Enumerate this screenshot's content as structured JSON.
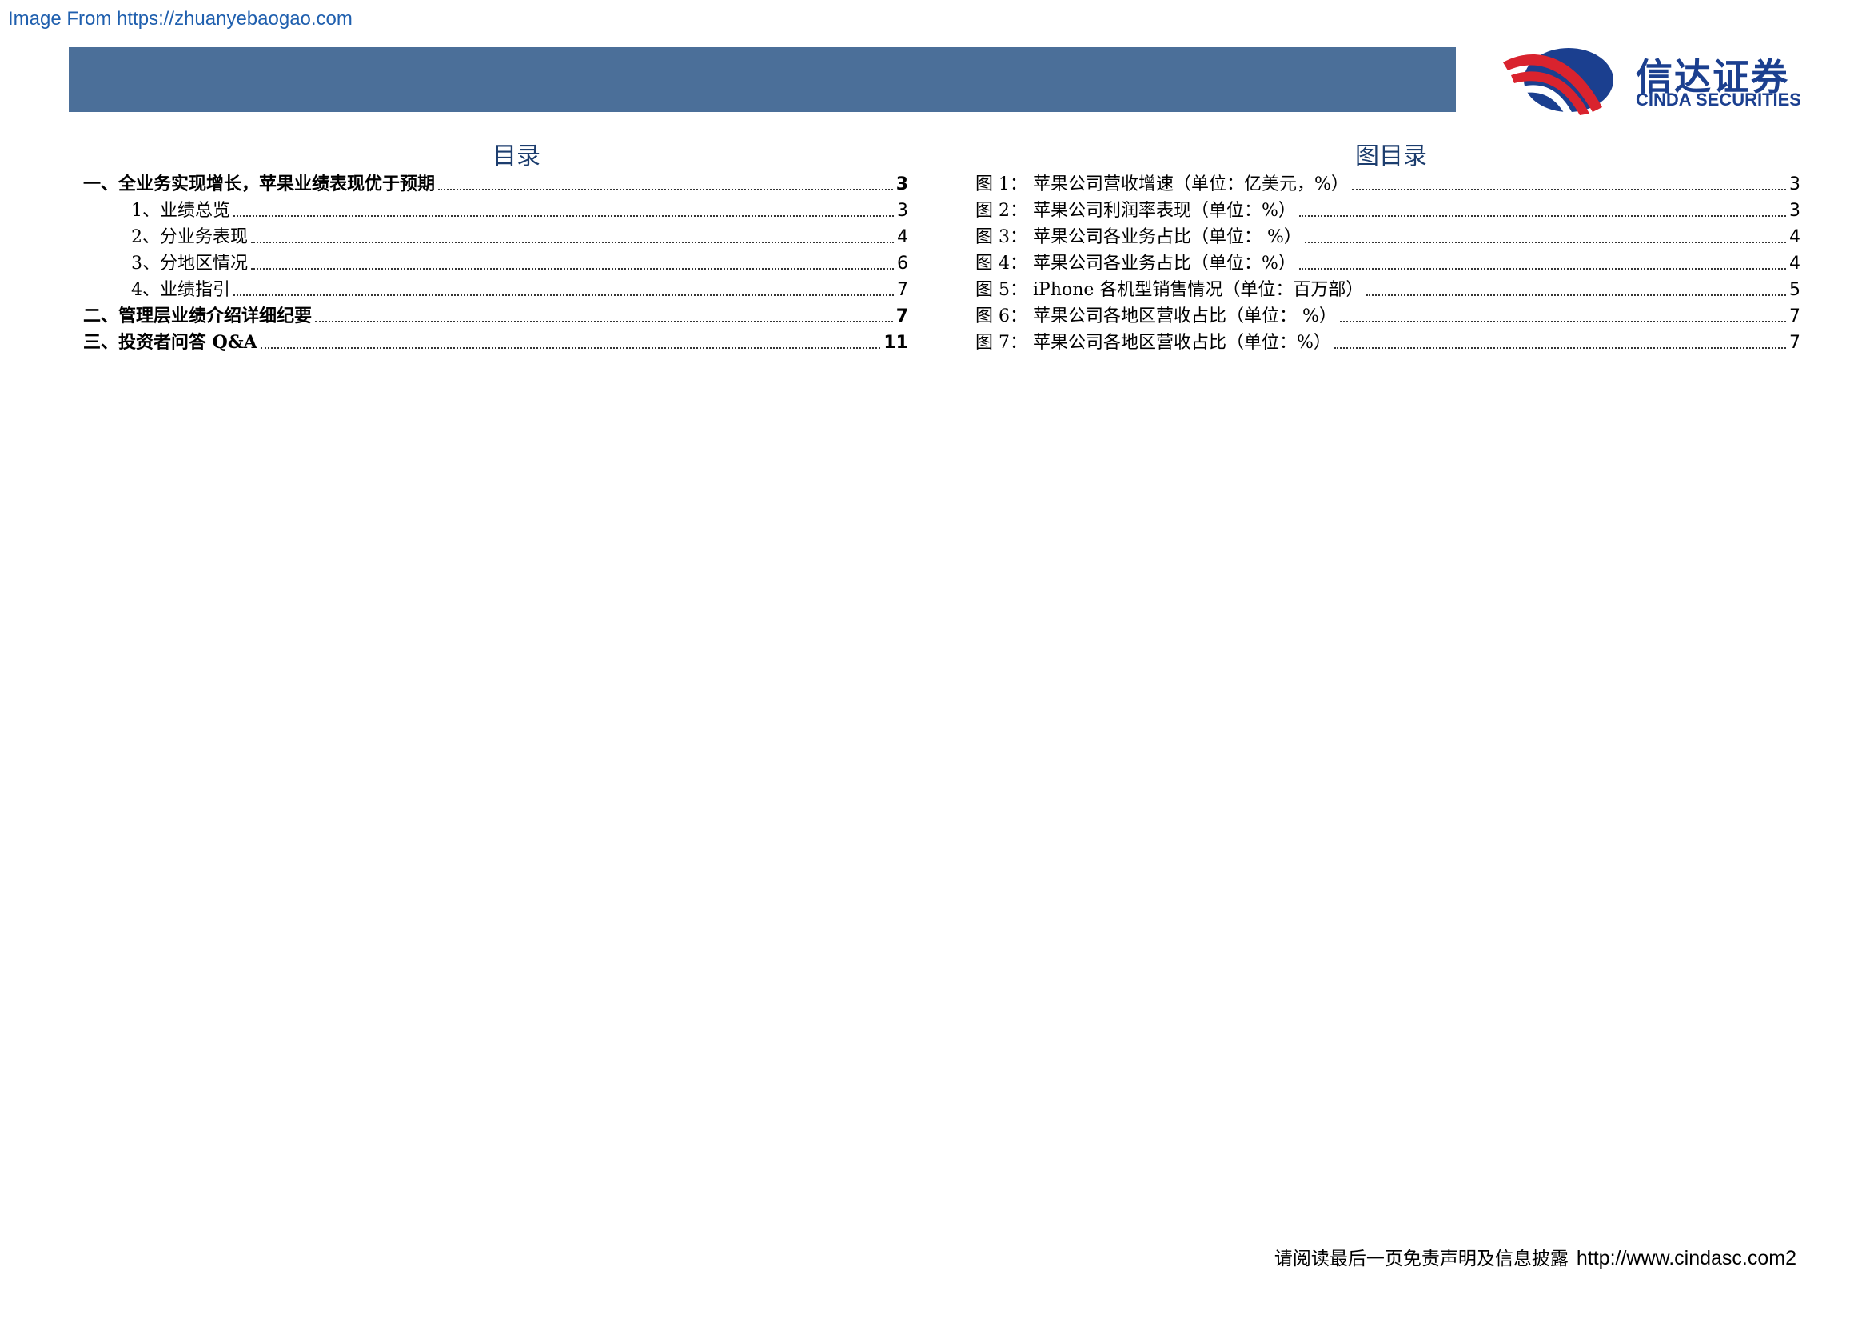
{
  "watermark": "Image From https://zhuanyebaogao.com",
  "logo": {
    "cn": "信达证券",
    "en": "CINDA SECURITIES",
    "colors": {
      "red": "#d9232e",
      "blue": "#1b3f8f"
    }
  },
  "banner_color": "#4b6f99",
  "toc": {
    "title": "目录",
    "items": [
      {
        "text": "一、全业务实现增长，苹果业绩表现优于预期",
        "page": "3",
        "level": 1
      },
      {
        "text": "1、业绩总览",
        "page": "3",
        "level": 2
      },
      {
        "text": "2、分业务表现",
        "page": "4",
        "level": 2
      },
      {
        "text": "3、分地区情况",
        "page": "6",
        "level": 2
      },
      {
        "text": "4、业绩指引",
        "page": "7",
        "level": 2
      },
      {
        "text": "二、管理层业绩介绍详细纪要",
        "page": "7",
        "level": 1
      },
      {
        "text": "三、投资者问答 Q&A",
        "page": "11",
        "level": 1
      }
    ]
  },
  "figures": {
    "title": "图目录",
    "items": [
      {
        "text": "图 1：  苹果公司营收增速（单位：亿美元，%）",
        "page": "3"
      },
      {
        "text": "图 2：  苹果公司利润率表现（单位：%）",
        "page": "3"
      },
      {
        "text": "图 3：  苹果公司各业务占比（单位：  %）",
        "page": "4"
      },
      {
        "text": "图 4：  苹果公司各业务占比（单位：%）",
        "page": "4"
      },
      {
        "text": "图 5：  iPhone 各机型销售情况（单位：百万部）",
        "page": "5"
      },
      {
        "text": "图 6：  苹果公司各地区营收占比（单位：  %）",
        "page": "7"
      },
      {
        "text": "图 7：  苹果公司各地区营收占比（单位：%）",
        "page": "7"
      }
    ]
  },
  "footer": {
    "disclaimer": "请阅读最后一页免责声明及信息披露",
    "url": "http://www.cindasc.com2"
  }
}
